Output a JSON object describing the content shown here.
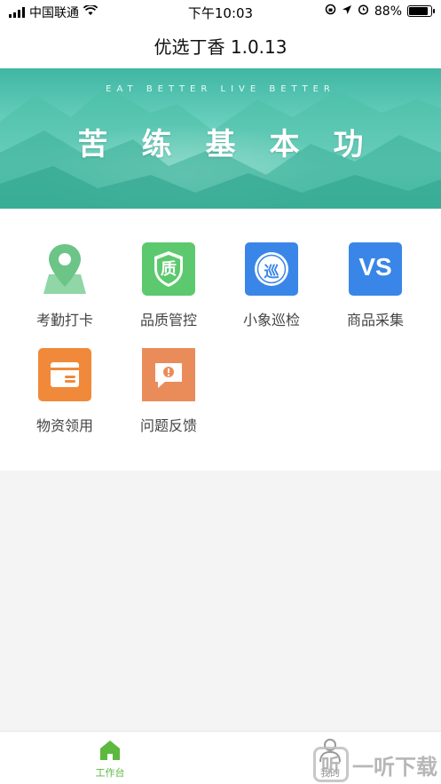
{
  "status_bar": {
    "carrier": "中国联通",
    "time": "下午10:03",
    "battery_percent": "88%",
    "battery_level": 0.88,
    "icons": [
      "signal-icon",
      "wifi-icon",
      "screen-rotation-lock-icon",
      "location-arrow-icon",
      "alarm-icon",
      "battery-icon"
    ]
  },
  "header": {
    "title": "优选丁香 1.0.13"
  },
  "banner": {
    "subtitle": "EAT BETTER  LIVE BETTER",
    "title": "苦练基本功"
  },
  "apps": [
    {
      "label": "考勤打卡",
      "icon": "location-pin-icon",
      "color": "#7ccf96"
    },
    {
      "label": "品质管控",
      "icon": "shield-quality-icon",
      "icon_text": "质",
      "color": "#5cc96e"
    },
    {
      "label": "小象巡检",
      "icon": "patrol-icon",
      "icon_text": "巡",
      "color": "#3a86e8"
    },
    {
      "label": "商品采集",
      "icon": "vs-icon",
      "icon_text": "VS",
      "color": "#3a86e8"
    },
    {
      "label": "物资领用",
      "icon": "wallet-icon",
      "color": "#f08a3a"
    },
    {
      "label": "问题反馈",
      "icon": "feedback-icon",
      "color": "#ea8c5a"
    }
  ],
  "tabbar": {
    "items": [
      {
        "label": "工作台",
        "icon": "home-icon",
        "active": true,
        "color": "#5ab93e"
      },
      {
        "label": "我的",
        "icon": "user-icon",
        "active": false,
        "color": "#999999"
      }
    ]
  },
  "watermark": {
    "text": "一听下载",
    "icon_text": "听"
  }
}
